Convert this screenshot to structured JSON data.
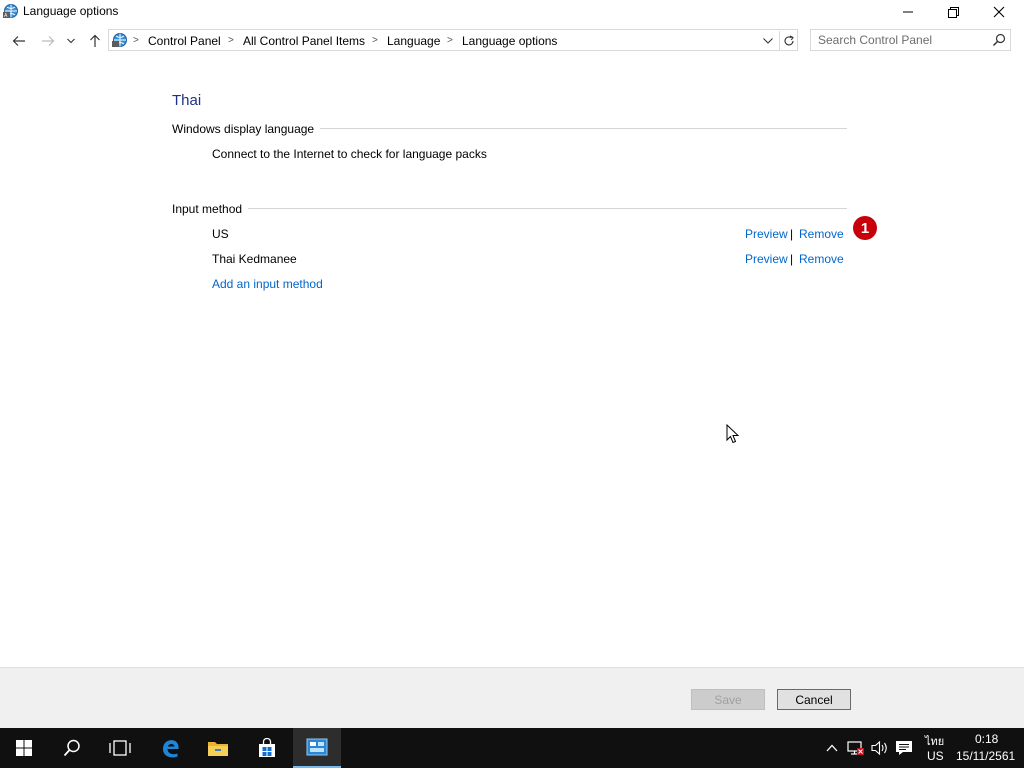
{
  "window": {
    "title": "Language options"
  },
  "nav": {
    "breadcrumb": [
      "Control Panel",
      "All Control Panel Items",
      "Language",
      "Language options"
    ],
    "search_placeholder": "Search Control Panel"
  },
  "main": {
    "language_name": "Thai",
    "display_section": {
      "heading": "Windows display language",
      "message": "Connect to the Internet to check for language packs"
    },
    "input_section": {
      "heading": "Input method",
      "methods": [
        {
          "name": "US",
          "preview_label": "Preview",
          "remove_label": "Remove"
        },
        {
          "name": "Thai Kedmanee",
          "preview_label": "Preview",
          "remove_label": "Remove"
        }
      ],
      "add_label": "Add an input method"
    },
    "annotation_badge": "1"
  },
  "footer": {
    "save_label": "Save",
    "cancel_label": "Cancel"
  },
  "taskbar": {
    "language_indicator": "ไทย",
    "keyboard_indicator": "US",
    "time": "0:18",
    "date": "15/11/2561"
  },
  "colors": {
    "link": "#0066cc",
    "heading": "#1e3287",
    "badge": "#c8000a",
    "taskbar": "#101010"
  },
  "icons": [
    "control-panel-icon",
    "minimize-icon",
    "maximize-icon",
    "close-icon",
    "back-arrow-icon",
    "forward-arrow-icon",
    "recent-dropdown-icon",
    "up-arrow-icon",
    "chevron-down-icon",
    "refresh-icon",
    "search-icon",
    "windows-start-icon",
    "search-taskbar-icon",
    "task-view-icon",
    "edge-icon",
    "file-explorer-icon",
    "store-icon",
    "control-panel-taskbar-icon",
    "chevron-up-icon",
    "network-icon",
    "volume-icon",
    "notification-icon"
  ]
}
